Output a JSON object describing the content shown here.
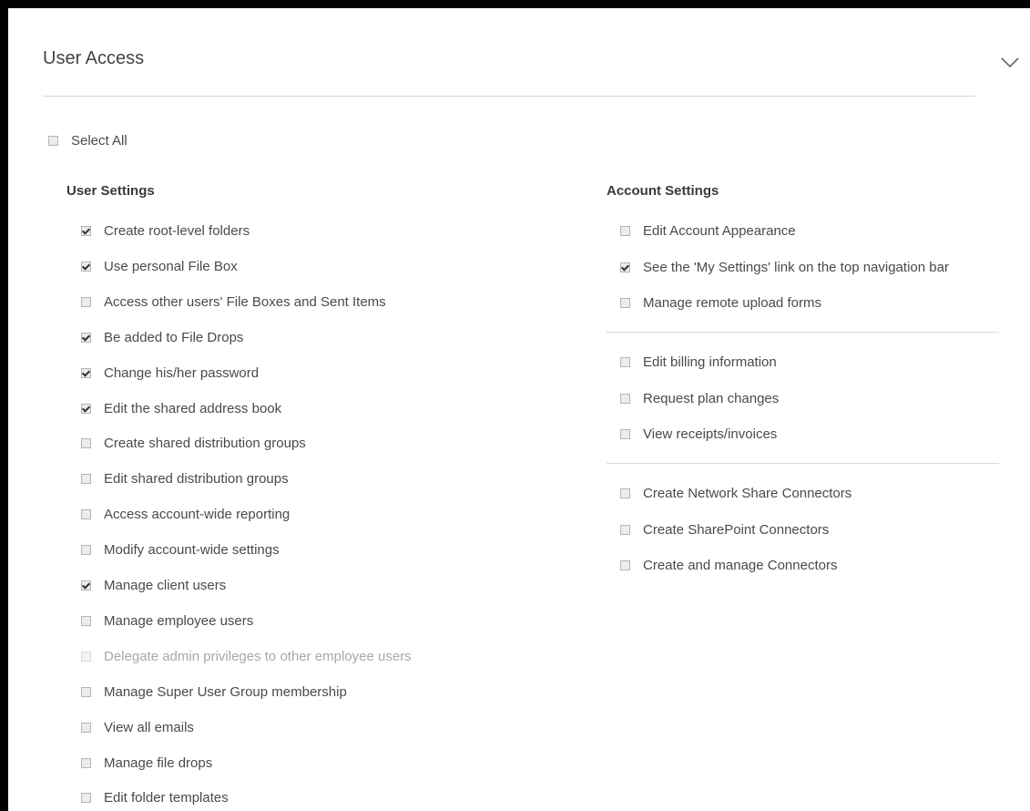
{
  "panel": {
    "title": "User Access",
    "collapse_icon": "chevron-down-icon"
  },
  "select_all": {
    "label": "Select All",
    "checked": false
  },
  "user_settings": {
    "heading": "User Settings",
    "items": [
      {
        "label": "Create root-level folders",
        "checked": true,
        "disabled": false
      },
      {
        "label": "Use personal File Box",
        "checked": true,
        "disabled": false
      },
      {
        "label": "Access other users' File Boxes and Sent Items",
        "checked": false,
        "disabled": false
      },
      {
        "label": "Be added to File Drops",
        "checked": true,
        "disabled": false
      },
      {
        "label": "Change his/her password",
        "checked": true,
        "disabled": false
      },
      {
        "label": "Edit the shared address book",
        "checked": true,
        "disabled": false
      },
      {
        "label": "Create shared distribution groups",
        "checked": false,
        "disabled": false
      },
      {
        "label": "Edit shared distribution groups",
        "checked": false,
        "disabled": false
      },
      {
        "label": "Access account-wide reporting",
        "checked": false,
        "disabled": false
      },
      {
        "label": "Modify account-wide settings",
        "checked": false,
        "disabled": false
      },
      {
        "label": "Manage client users",
        "checked": true,
        "disabled": false
      },
      {
        "label": "Manage employee users",
        "checked": false,
        "disabled": false
      },
      {
        "label": "Delegate admin privileges to other employee users",
        "checked": false,
        "disabled": true
      },
      {
        "label": "Manage Super User Group membership",
        "checked": false,
        "disabled": false
      },
      {
        "label": "View all emails",
        "checked": false,
        "disabled": false
      },
      {
        "label": "Manage file drops",
        "checked": false,
        "disabled": false
      },
      {
        "label": "Edit folder templates",
        "checked": false,
        "disabled": false
      }
    ]
  },
  "account_settings": {
    "heading": "Account Settings",
    "groups": [
      [
        {
          "label": "Edit Account Appearance",
          "checked": false,
          "disabled": false
        },
        {
          "label": "See the 'My Settings' link on the top navigation bar",
          "checked": true,
          "disabled": false
        },
        {
          "label": "Manage remote upload forms",
          "checked": false,
          "disabled": false
        }
      ],
      [
        {
          "label": "Edit billing information",
          "checked": false,
          "disabled": false
        },
        {
          "label": "Request plan changes",
          "checked": false,
          "disabled": false
        },
        {
          "label": "View receipts/invoices",
          "checked": false,
          "disabled": false
        }
      ],
      [
        {
          "label": "Create Network Share Connectors",
          "checked": false,
          "disabled": false
        },
        {
          "label": "Create SharePoint Connectors",
          "checked": false,
          "disabled": false
        },
        {
          "label": "Create and manage Connectors",
          "checked": false,
          "disabled": false
        }
      ]
    ]
  }
}
